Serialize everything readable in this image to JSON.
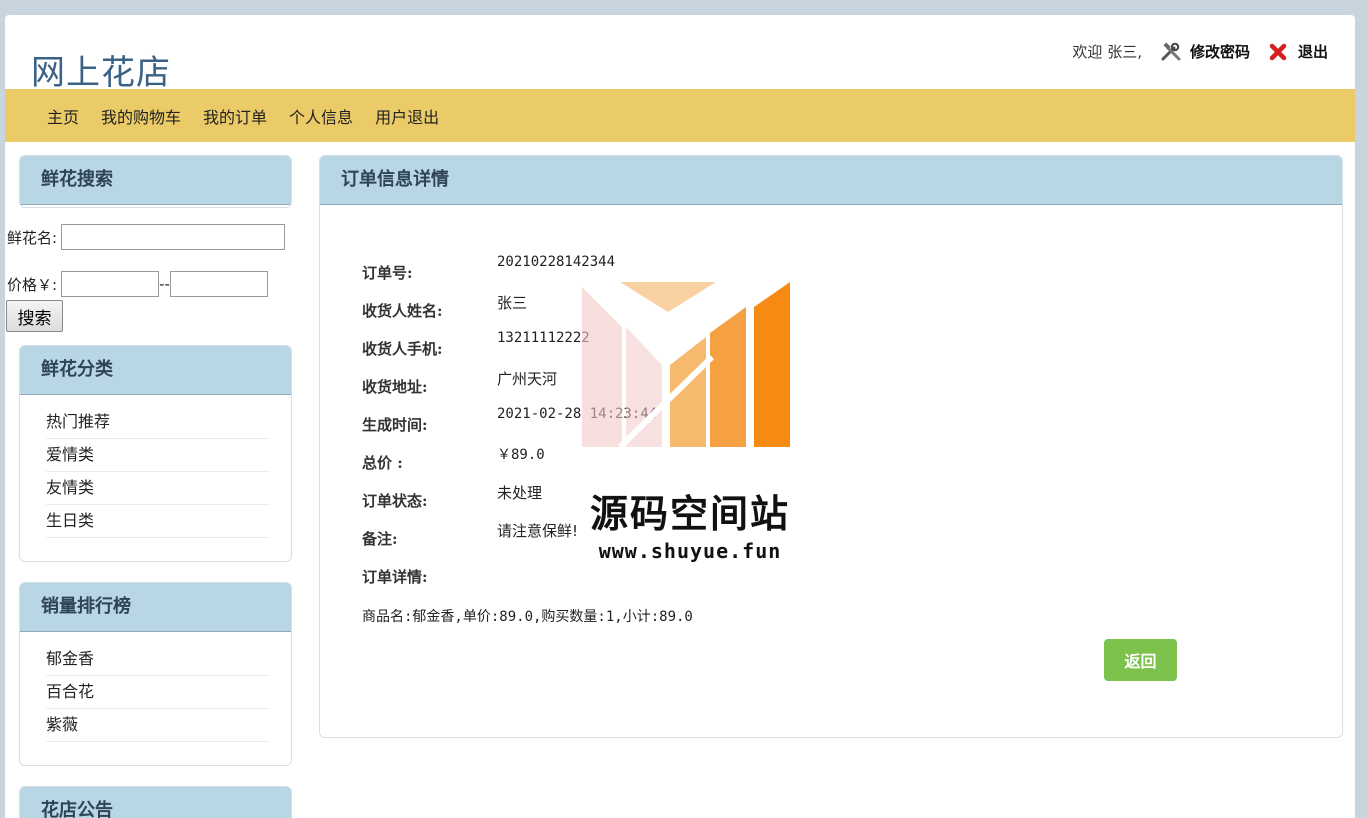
{
  "site": {
    "title": "网上花店"
  },
  "topbar": {
    "welcome": "欢迎 张三,",
    "change_password": "修改密码",
    "logout": "退出"
  },
  "nav": [
    "主页",
    "我的购物车",
    "我的订单",
    "个人信息",
    "用户退出"
  ],
  "sidebar": {
    "search": {
      "title": "鲜花搜索",
      "name_label": "鲜花名:",
      "price_label": "价格￥:",
      "price_sep": "--",
      "button": "搜索"
    },
    "categories": {
      "title": "鲜花分类",
      "items": [
        "热门推荐",
        "爱情类",
        "友情类",
        "生日类"
      ]
    },
    "ranking": {
      "title": "销量排行榜",
      "items": [
        "郁金香",
        "百合花",
        "紫薇"
      ]
    },
    "notice": {
      "title": "花店公告"
    }
  },
  "order": {
    "title": "订单信息详情",
    "fields": [
      {
        "label": "订单号:",
        "value": "20210228142344"
      },
      {
        "label": "收货人姓名:",
        "value": "张三"
      },
      {
        "label": "收货人手机:",
        "value": "13211112222"
      },
      {
        "label": "收货地址:",
        "value": "广州天河"
      },
      {
        "label": "生成时间:",
        "value": "2021-02-28 14:23:44"
      },
      {
        "label": "总价 :",
        "value": "￥89.0"
      },
      {
        "label": "订单状态:",
        "value": "未处理"
      },
      {
        "label": "备注:",
        "value": "请注意保鲜!"
      },
      {
        "label": "订单详情:",
        "value": ""
      }
    ],
    "goods_line": "商品名:郁金香,单价:89.0,购买数量:1,小计:89.0",
    "back_button": "返回"
  },
  "watermark": {
    "text": "源码空间站",
    "url": "www.shuyue.fun"
  },
  "colors": {
    "nav_bg": "#ebcb67",
    "panel_head": "#b8d6e4",
    "back_button": "#7dc24c",
    "title": "#3a6286"
  }
}
